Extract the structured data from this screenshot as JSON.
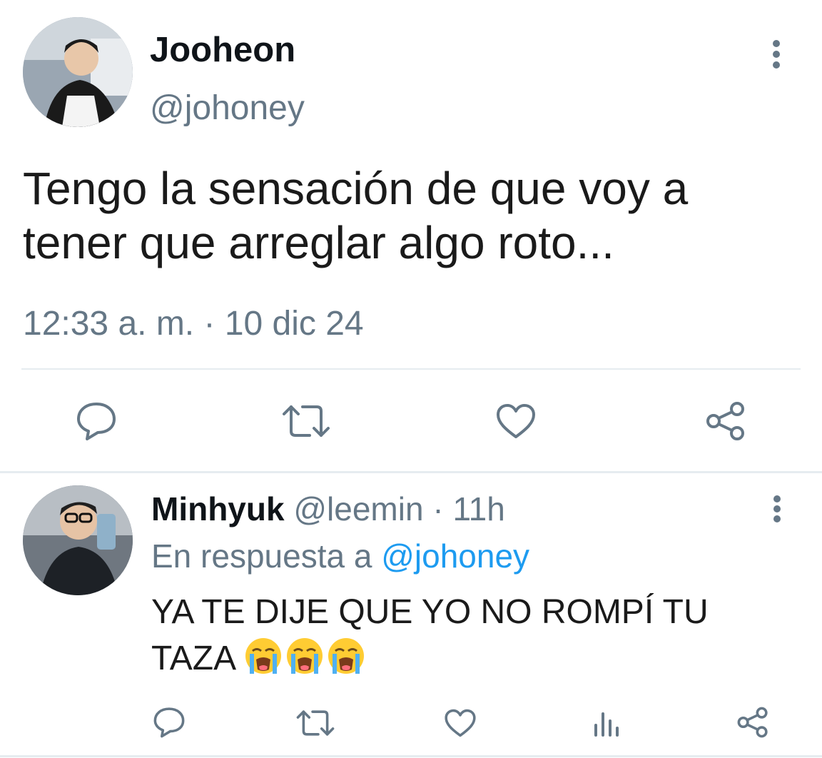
{
  "main_tweet": {
    "author_name": "Jooheon",
    "handle": "@johoney",
    "text_line1": "Tengo la sensación de que voy a",
    "text_line2": "tener que arreglar algo roto...",
    "time": "12:33 a. m.",
    "separator": "·",
    "date": "10 dic 24",
    "actions": [
      "reply-icon",
      "retweet-icon",
      "like-icon",
      "share-icon"
    ]
  },
  "reply_tweet": {
    "author_name": "Minhyuk",
    "handle": "@leemin",
    "separator": "·",
    "age": "11h",
    "reply_prefix": "En respuesta a",
    "reply_to": "@johoney",
    "text_line1": "YA TE DIJE QUE YO NO ROMPÍ TU",
    "text_line2": "TAZA",
    "emoji": [
      "loudly-crying-face",
      "loudly-crying-face",
      "loudly-crying-face"
    ],
    "actions": [
      "reply-icon",
      "retweet-icon",
      "like-icon",
      "analytics-icon",
      "share-icon"
    ]
  },
  "colors": {
    "text": "#0f1419",
    "muted": "#657786",
    "link": "#1d9bf0",
    "divider": "#e6ecf0"
  }
}
